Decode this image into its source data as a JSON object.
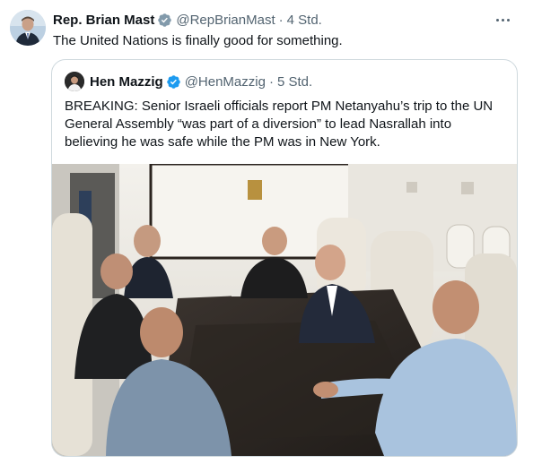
{
  "tweet": {
    "author_name": "Rep. Brian Mast",
    "author_handle": "@RepBrianMast",
    "separator": "·",
    "timestamp": "4 Std.",
    "text": "The United Nations is finally good for something.",
    "verified_color": "#829aab"
  },
  "quoted_tweet": {
    "author_name": "Hen Mazzig",
    "author_handle": "@HenMazzig",
    "separator": "·",
    "timestamp": "5 Std.",
    "text": "BREAKING: Senior Israeli officials report PM Netanyahu’s trip to the UN General Assembly “was part of a diversion” to lead Nasrallah into believing he was safe while the PM was in New York.",
    "verified_color": "#1d9bf0"
  },
  "colors": {
    "primary_text": "#0f1419",
    "secondary_text": "#536471",
    "border": "#cfd9de"
  },
  "icons": {
    "more": "more-horizontal-icon",
    "verified": "verified-badge-icon"
  }
}
